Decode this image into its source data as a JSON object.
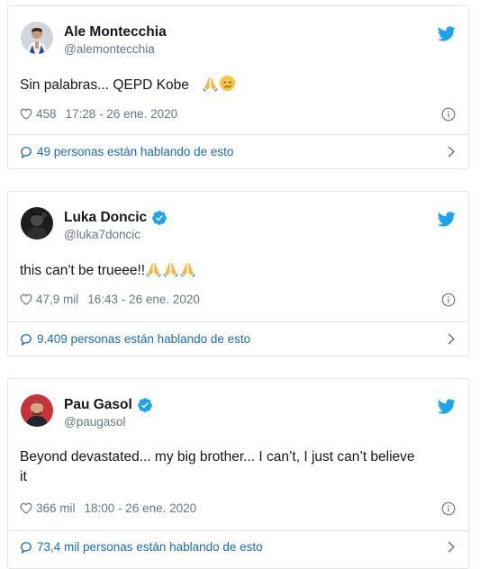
{
  "tweets": [
    {
      "display_name": "Ale Montecchia",
      "handle": "@alemontecchia",
      "verified": false,
      "text": "Sin palabras... QEPD Kobe",
      "emojis": [
        "folded-hands",
        "sad-face"
      ],
      "likes": "458",
      "time": "17:28 - 26 ene. 2020",
      "conversation": "49 personas están hablando de esto"
    },
    {
      "display_name": "Luka Doncic",
      "handle": "@luka7doncic",
      "verified": true,
      "text": "this can't be trueee!!",
      "emojis": [
        "folded-hands",
        "folded-hands",
        "folded-hands"
      ],
      "likes": "47,9 mil",
      "time": "16:43 - 26 ene. 2020",
      "conversation": "9.409 personas están hablando de esto"
    },
    {
      "display_name": "Pau Gasol",
      "handle": "@paugasol",
      "verified": true,
      "text_line1": "Beyond devastated... my big brother... I can’t, I just can’t believe",
      "text_line2": "it",
      "likes": "366 mil",
      "time": "18:00 - 26 ene. 2020",
      "conversation": "73,4 mil personas están hablando de esto"
    }
  ],
  "colors": {
    "twitter_blue": "#1da1f2",
    "link_blue": "#1b6bb0",
    "gray_text": "#657786",
    "border": "#e1e8ed"
  }
}
